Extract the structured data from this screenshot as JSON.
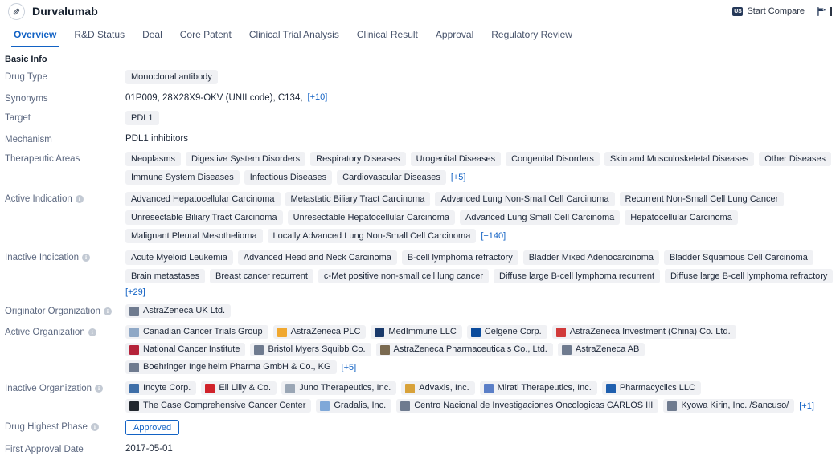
{
  "header": {
    "drug_name": "Durvalumab",
    "drug_icon": "capsule-icon",
    "compare_label": "Start Compare",
    "compare_badge": "US",
    "right_icon": "filter-flag-icon"
  },
  "tabs": [
    {
      "label": "Overview",
      "active": true
    },
    {
      "label": "R&D Status",
      "active": false
    },
    {
      "label": "Deal",
      "active": false
    },
    {
      "label": "Core Patent",
      "active": false
    },
    {
      "label": "Clinical Trial Analysis",
      "active": false
    },
    {
      "label": "Clinical Result",
      "active": false
    },
    {
      "label": "Approval",
      "active": false
    },
    {
      "label": "Regulatory Review",
      "active": false
    }
  ],
  "basic_info": {
    "section_title": "Basic Info",
    "drug_type": {
      "label": "Drug Type",
      "chips": [
        "Monoclonal antibody"
      ]
    },
    "synonyms": {
      "label": "Synonyms",
      "text": "01P009,  28X28X9-OKV (UNII code),  C134,",
      "more": "[+10]"
    },
    "target": {
      "label": "Target",
      "chips": [
        "PDL1"
      ]
    },
    "mechanism": {
      "label": "Mechanism",
      "text": "PDL1 inhibitors"
    },
    "therapeutic_areas": {
      "label": "Therapeutic Areas",
      "chips": [
        "Neoplasms",
        "Digestive System Disorders",
        "Respiratory Diseases",
        "Urogenital Diseases",
        "Congenital Disorders",
        "Skin and Musculoskeletal Diseases",
        "Other Diseases",
        "Immune System Diseases",
        "Infectious Diseases",
        "Cardiovascular Diseases"
      ],
      "more": "[+5]"
    },
    "active_indication": {
      "label": "Active Indication",
      "has_info": true,
      "chips": [
        "Advanced Hepatocellular Carcinoma",
        "Metastatic Biliary Tract Carcinoma",
        "Advanced Lung Non-Small Cell Carcinoma",
        "Recurrent Non-Small Cell Lung Cancer",
        "Unresectable Biliary Tract Carcinoma",
        "Unresectable Hepatocellular Carcinoma",
        "Advanced Lung Small Cell Carcinoma",
        "Hepatocellular Carcinoma",
        "Malignant Pleural Mesothelioma",
        "Locally Advanced Lung Non-Small Cell Carcinoma"
      ],
      "more": "[+140]"
    },
    "inactive_indication": {
      "label": "Inactive Indication",
      "has_info": true,
      "chips": [
        "Acute Myeloid Leukemia",
        "Advanced Head and Neck Carcinoma",
        "B-cell lymphoma refractory",
        "Bladder Mixed Adenocarcinoma",
        "Bladder Squamous Cell Carcinoma",
        "Brain metastases",
        "Breast cancer recurrent",
        "c-Met positive non-small cell lung cancer",
        "Diffuse large B-cell lymphoma recurrent",
        "Diffuse large B-cell lymphoma refractory"
      ],
      "more": "[+29]"
    },
    "originator_organization": {
      "label": "Originator Organization",
      "has_info": true,
      "orgs": [
        {
          "name": "AstraZeneca UK Ltd.",
          "logo": "#6f7b8f"
        }
      ]
    },
    "active_organization": {
      "label": "Active Organization",
      "has_info": true,
      "orgs": [
        {
          "name": "Canadian Cancer Trials Group",
          "logo": "#8fa8c6"
        },
        {
          "name": "AstraZeneca PLC",
          "logo": "#f0a830"
        },
        {
          "name": "MedImmune LLC",
          "logo": "#1a3a6b"
        },
        {
          "name": "Celgene Corp.",
          "logo": "#0b4b9c"
        },
        {
          "name": "AstraZeneca Investment (China) Co. Ltd.",
          "logo": "#d13a3a"
        },
        {
          "name": "National Cancer Institute",
          "logo": "#b5233a"
        },
        {
          "name": "Bristol Myers Squibb Co.",
          "logo": "#6f7b8f"
        },
        {
          "name": "AstraZeneca Pharmaceuticals Co., Ltd.",
          "logo": "#7a6a50"
        },
        {
          "name": "AstraZeneca AB",
          "logo": "#6f7b8f"
        },
        {
          "name": "Boehringer Ingelheim Pharma GmbH & Co., KG",
          "logo": "#6f7b8f"
        }
      ],
      "more": "[+5]"
    },
    "inactive_organization": {
      "label": "Inactive Organization",
      "has_info": true,
      "orgs": [
        {
          "name": "Incyte Corp.",
          "logo": "#3f6fa8"
        },
        {
          "name": "Eli Lilly & Co.",
          "logo": "#d0232b"
        },
        {
          "name": "Juno Therapeutics, Inc.",
          "logo": "#9aa6b5"
        },
        {
          "name": "Advaxis, Inc.",
          "logo": "#d8a23a"
        },
        {
          "name": "Mirati Therapeutics, Inc.",
          "logo": "#5b7fc7"
        },
        {
          "name": "Pharmacyclics LLC",
          "logo": "#1f5fae"
        },
        {
          "name": "The Case Comprehensive Cancer Center",
          "logo": "#22272e"
        },
        {
          "name": "Gradalis, Inc.",
          "logo": "#7fa8d8"
        },
        {
          "name": "Centro Nacional de Investigaciones Oncologicas CARLOS III",
          "logo": "#6f7b8f"
        },
        {
          "name": "Kyowa Kirin, Inc. /Sancuso/",
          "logo": "#6f7b8f"
        }
      ],
      "more": "[+1]"
    },
    "drug_highest_phase": {
      "label": "Drug Highest Phase",
      "has_info": true,
      "badge": "Approved"
    },
    "first_approval_date": {
      "label": "First Approval Date",
      "text": "2017-05-01"
    }
  },
  "colors": {
    "accent": "#1262c4",
    "chip_bg": "#f0f1f4",
    "label": "#5c6880"
  }
}
